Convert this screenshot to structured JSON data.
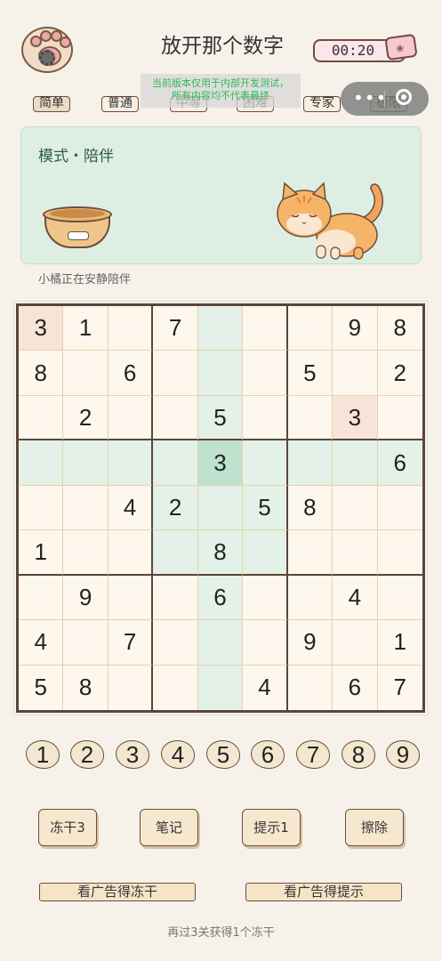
{
  "header": {
    "title": "放开那个数字",
    "timer": "00:20"
  },
  "difficulty_tabs": [
    "简单",
    "普通",
    "中等",
    "困难",
    "专家",
    "极限"
  ],
  "active_tab_index": 0,
  "notice": {
    "line1": "当前版本仅用于内部开发测试，",
    "line2": "所有内容均不代表最终"
  },
  "companion": {
    "mode_label": "模式・陪伴",
    "status_text": "小橘正在安静陪伴"
  },
  "board": {
    "rows": [
      [
        "3",
        "1",
        "",
        "7",
        "",
        "",
        "",
        "9",
        "8"
      ],
      [
        "8",
        "",
        "6",
        "",
        "",
        "",
        "5",
        "",
        "2"
      ],
      [
        "",
        "2",
        "",
        "",
        "5",
        "",
        "",
        "3",
        ""
      ],
      [
        "",
        "",
        "",
        "",
        "3",
        "",
        "",
        "",
        "6"
      ],
      [
        "",
        "",
        "4",
        "2",
        "",
        "5",
        "8",
        "",
        ""
      ],
      [
        "1",
        "",
        "",
        "",
        "8",
        "",
        "",
        "",
        ""
      ],
      [
        "",
        "9",
        "",
        "",
        "6",
        "",
        "",
        "4",
        ""
      ],
      [
        "4",
        "",
        "7",
        "",
        "",
        "",
        "9",
        "",
        "1"
      ],
      [
        "5",
        "8",
        "",
        "",
        "",
        "4",
        "",
        "6",
        "7"
      ]
    ],
    "selected_cell": {
      "row": 3,
      "col": 4
    },
    "conflict_cells": [
      {
        "row": 0,
        "col": 0
      },
      {
        "row": 2,
        "col": 7
      }
    ]
  },
  "number_pad": [
    "1",
    "2",
    "3",
    "4",
    "5",
    "6",
    "7",
    "8",
    "9"
  ],
  "actions": {
    "freeze": "冻干3",
    "notes": "笔记",
    "hint": "提示1",
    "erase": "擦除"
  },
  "ads": {
    "freeze": "看广告得冻干",
    "hint": "看广告得提示"
  },
  "footer_text": "再过3关获得1个冻干"
}
